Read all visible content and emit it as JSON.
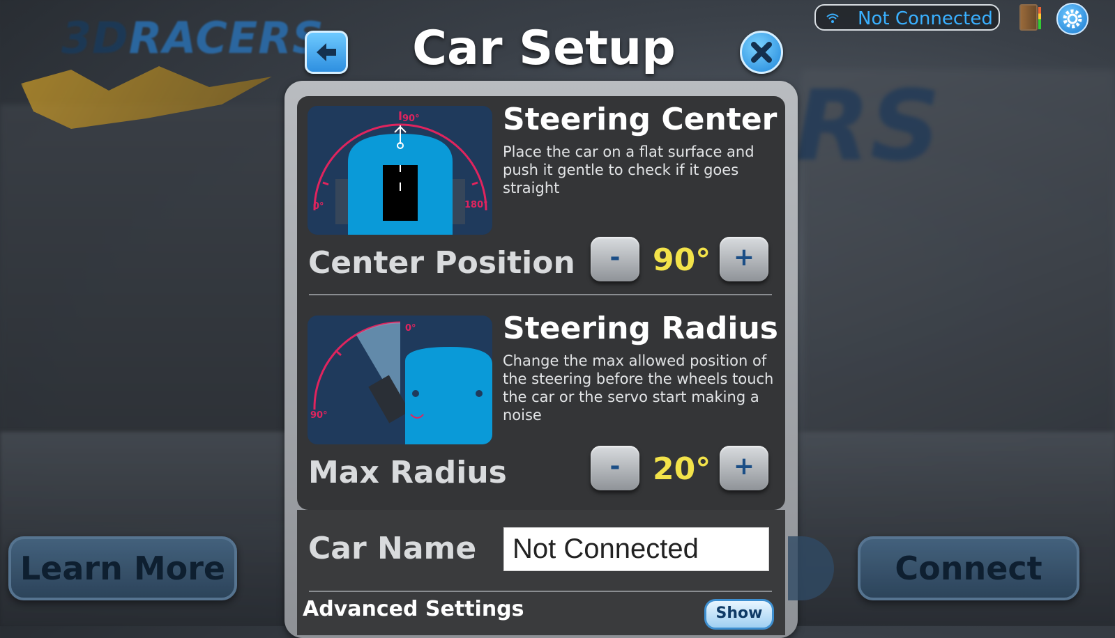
{
  "header": {
    "title": "Car Setup"
  },
  "status": {
    "connection_text": "Not Connected",
    "accent": "#3ab0ff"
  },
  "background": {
    "logo_part1": "3D",
    "logo_part2": "RACERS",
    "big_text": "RS"
  },
  "steering_center": {
    "title": "Steering Center",
    "description": "Place the car on a flat surface and push it gentle to check if it goes straight",
    "gauge_top": "90°",
    "gauge_left": "0°",
    "gauge_right": "180°",
    "row_label": "Center Position",
    "value": "90°",
    "minus_label": "-",
    "plus_label": "+"
  },
  "steering_radius": {
    "title": "Steering Radius",
    "description": "Change the max allowed position of the steering before the wheels touch the car or the servo start making a noise",
    "gauge_top": "0°",
    "gauge_left": "90°",
    "row_label": "Max Radius",
    "value": "20°",
    "minus_label": "-",
    "plus_label": "+"
  },
  "car_name": {
    "label": "Car Name",
    "value": "Not Connected"
  },
  "advanced": {
    "label": "Advanced Settings",
    "show_label": "Show"
  },
  "bottom": {
    "learn_more_label": "Learn More",
    "connect_label": "Connect"
  },
  "colors": {
    "value_yellow": "#f3e34a",
    "gauge_arc": "#e0245e",
    "car_blue": "#0a9ad8"
  }
}
